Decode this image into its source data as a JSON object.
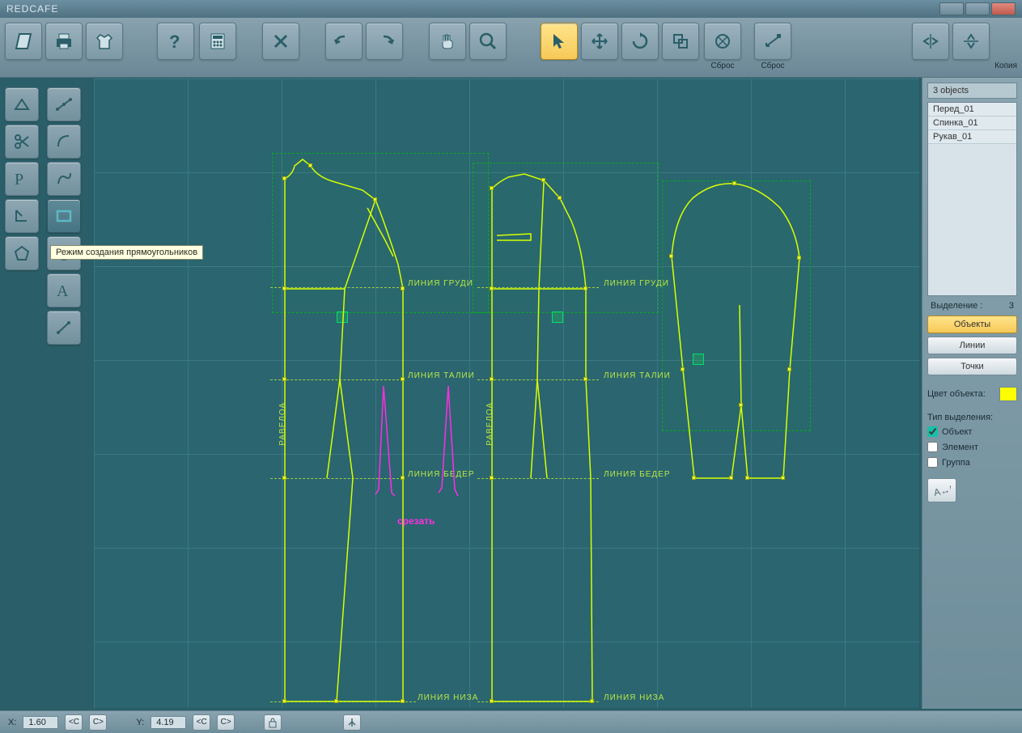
{
  "app_title": "REDCAFE",
  "toolbar": {
    "reset1_label": "Сброс",
    "reset2_label": "Сброс",
    "copy_label": "Копия"
  },
  "side_tooltip": "Режим создания прямоугольников",
  "annotations": {
    "chest_label": "ЛИНИЯ  ГРУДИ",
    "waist_label": "ЛИНИЯ  ТАЛИИ",
    "hip_label": "ЛИНИЯ  БЕДЕР",
    "hem_label": "ЛИНИЯ  НИЗА",
    "fold_label": "РАВЕЛОА",
    "cut_label": "срезать"
  },
  "right": {
    "header": "3 objects",
    "objects": [
      "Перед_01",
      "Спинка_01",
      "Рукав_01"
    ],
    "selection_label": "Выделение :",
    "selection_count": "3",
    "btn_objects": "Объекты",
    "btn_lines": "Линии",
    "btn_points": "Точки",
    "color_label": "Цвет объекта:",
    "seltype_label": "Тип выделения:",
    "seltype_opts": [
      "Объект",
      "Элемент",
      "Группа"
    ]
  },
  "status": {
    "x_label": "X:",
    "x_value": "1.60",
    "y_label": "Y:",
    "y_value": "4.19",
    "btn_c1": "<C",
    "btn_c2": "C>",
    "btn_c3": "<C",
    "btn_c4": "C>"
  }
}
